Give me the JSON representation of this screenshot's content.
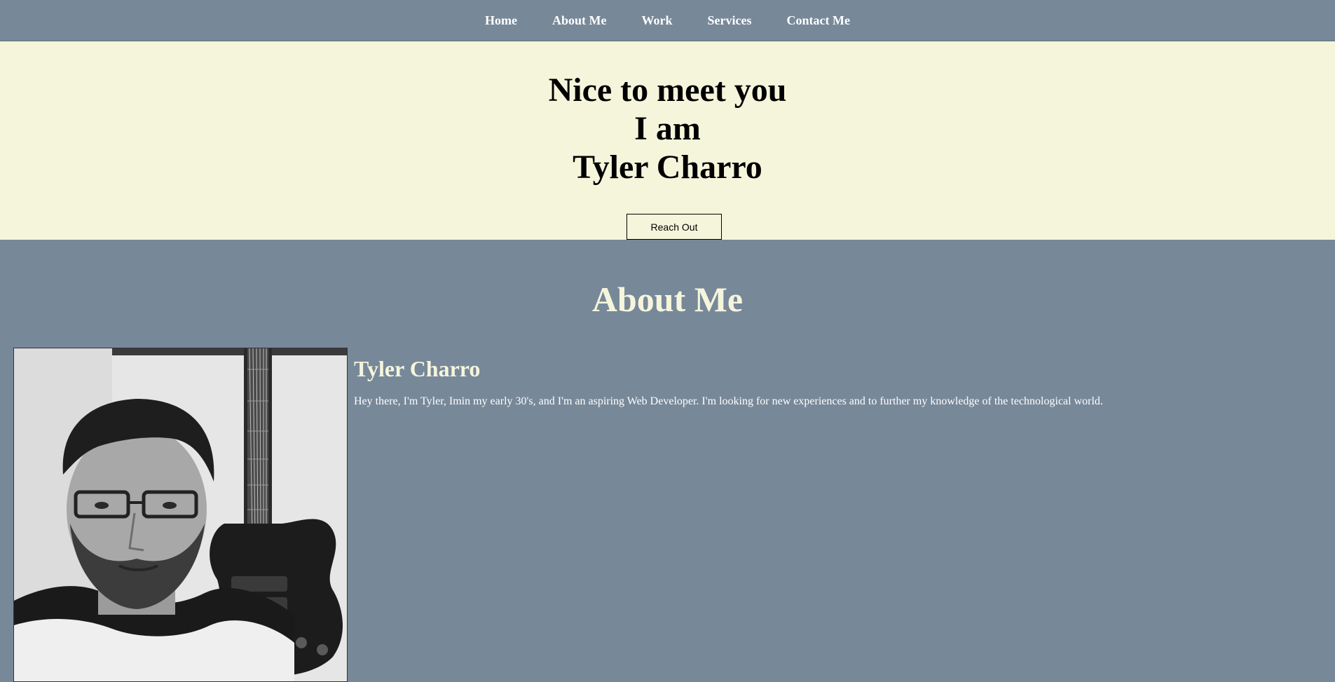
{
  "nav": {
    "items": [
      {
        "label": "Home"
      },
      {
        "label": "About Me"
      },
      {
        "label": "Work"
      },
      {
        "label": "Services"
      },
      {
        "label": "Contact Me"
      }
    ]
  },
  "hero": {
    "line1": "Nice to meet you",
    "line2": "I am",
    "line3": "Tyler Charro",
    "button_label": "Reach Out"
  },
  "about": {
    "heading": "About Me",
    "name": "Tyler Charro",
    "bio": "Hey there, I'm Tyler, Imin my early 30's, and I'm an aspiring Web Developer. I'm looking for new experiences and to further my knowledge of the technological world.",
    "photo_icon": "profile-photo"
  },
  "colors": {
    "nav_bg": "#778899",
    "hero_bg": "#f5f5dc",
    "about_bg": "#778899",
    "heading_color": "#f5f5dc"
  }
}
